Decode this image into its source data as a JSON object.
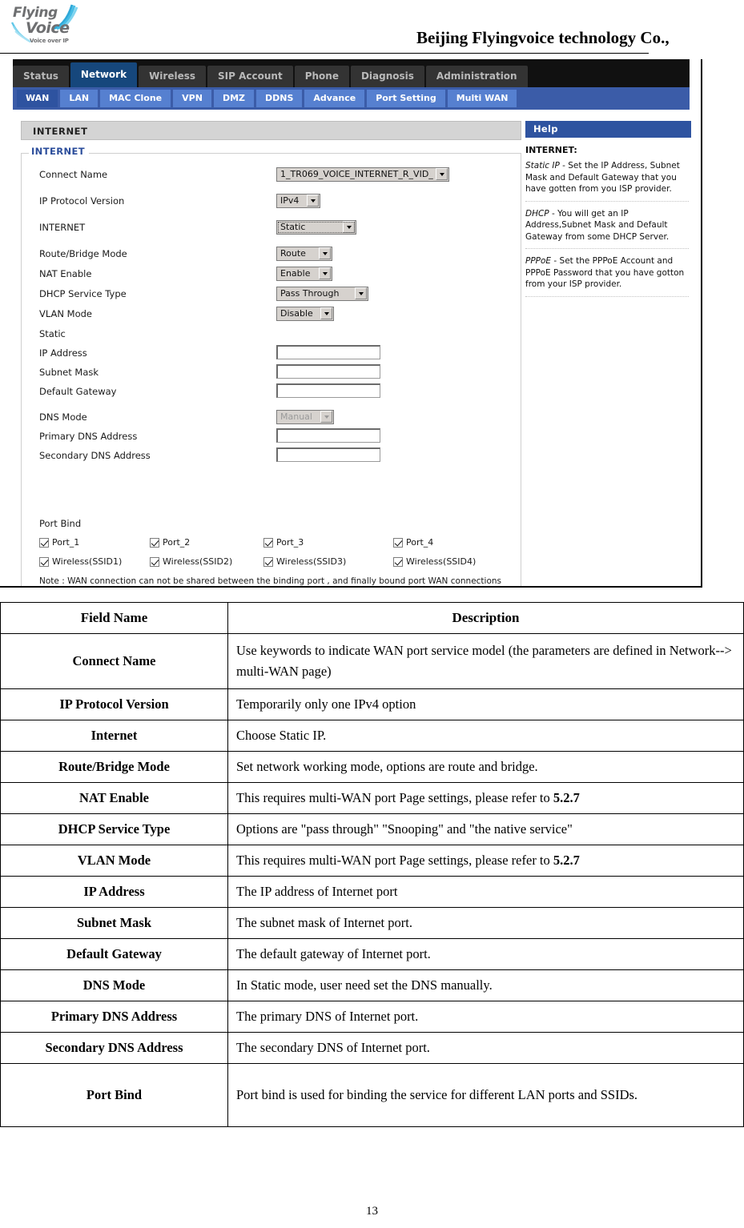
{
  "header": {
    "company": "Beijing Flyingvoice technology Co.,",
    "logo": {
      "word1": "Flying",
      "word2": "Voice",
      "tagline": "Voice over IP"
    }
  },
  "router": {
    "top_nav": [
      {
        "label": "Status",
        "active": false
      },
      {
        "label": "Network",
        "active": true
      },
      {
        "label": "Wireless",
        "active": false
      },
      {
        "label": "SIP Account",
        "active": false
      },
      {
        "label": "Phone",
        "active": false
      },
      {
        "label": "Diagnosis",
        "active": false
      },
      {
        "label": "Administration",
        "active": false
      }
    ],
    "sub_nav": [
      {
        "label": "WAN",
        "active": true
      },
      {
        "label": "LAN",
        "active": false
      },
      {
        "label": "MAC Clone",
        "active": false
      },
      {
        "label": "VPN",
        "active": false
      },
      {
        "label": "DMZ",
        "active": false
      },
      {
        "label": "DDNS",
        "active": false
      },
      {
        "label": "Advance",
        "active": false
      },
      {
        "label": "Port Setting",
        "active": false
      },
      {
        "label": "Multi WAN",
        "active": false
      }
    ],
    "section_title": "INTERNET",
    "fieldset_legend": "INTERNET",
    "form": {
      "connect_name": {
        "label": "Connect Name",
        "value": "1_TR069_VOICE_INTERNET_R_VID_"
      },
      "ip_protocol_version": {
        "label": "IP Protocol Version",
        "value": "IPv4"
      },
      "internet": {
        "label": "INTERNET",
        "value": "Static"
      },
      "route_bridge_mode": {
        "label": "Route/Bridge Mode",
        "value": "Route"
      },
      "nat_enable": {
        "label": "NAT Enable",
        "value": "Enable"
      },
      "dhcp_service_type": {
        "label": "DHCP Service Type",
        "value": "Pass Through"
      },
      "vlan_mode": {
        "label": "VLAN Mode",
        "value": "Disable"
      },
      "static_label": "Static",
      "ip_address": {
        "label": "IP Address",
        "value": ""
      },
      "subnet_mask": {
        "label": "Subnet Mask",
        "value": ""
      },
      "default_gateway": {
        "label": "Default Gateway",
        "value": ""
      },
      "dns_mode": {
        "label": "DNS Mode",
        "value": "Manual"
      },
      "primary_dns": {
        "label": "Primary DNS Address",
        "value": ""
      },
      "secondary_dns": {
        "label": "Secondary DNS Address",
        "value": ""
      }
    },
    "port_bind": {
      "label": "Port Bind",
      "ports": [
        "Port_1",
        "Port_2",
        "Port_3",
        "Port_4"
      ],
      "wireless": [
        "Wireless(SSID1)",
        "Wireless(SSID2)",
        "Wireless(SSID3)",
        "Wireless(SSID4)"
      ],
      "note": "Note : WAN connection can not be shared between the binding port , and finally bound port WAN connections bind operation will wash away before the other WAN connection to the port binding operation !"
    },
    "help": {
      "title": "Help",
      "heading": "INTERNET:",
      "blocks": [
        {
          "term": "Static IP",
          "text": " - Set the IP Address, Subnet Mask and Default Gateway that you have gotten from you ISP provider."
        },
        {
          "term": "DHCP",
          "text": " - You will get an IP Address,Subnet Mask and Default Gateway from some DHCP Server."
        },
        {
          "term": "PPPoE",
          "text": " - Set the PPPoE Account and PPPoE Password that you have gotton from your ISP provider."
        }
      ]
    }
  },
  "table": {
    "headers": [
      "Field Name",
      "Description"
    ],
    "rows": [
      {
        "field": "Connect    Name",
        "desc": "Use keywords to indicate WAN port service model (the parameters are defined in Network--> multi-WAN page)",
        "two_line": true
      },
      {
        "field": "IP Protocol Version",
        "desc": "Temporarily only one IPv4 option",
        "two_line": false
      },
      {
        "field": "Internet",
        "desc": "Choose Static IP.",
        "two_line": false
      },
      {
        "field": "Route/Bridge Mode",
        "desc": "Set network working mode, options are route and bridge.",
        "two_line": false
      },
      {
        "field": "NAT Enable",
        "desc": "This requires multi-WAN port Page settings, please refer to ",
        "ref": "5.2.7",
        "two_line": false
      },
      {
        "field": "DHCP Service Type",
        "desc": "Options are \"pass through\" \"Snooping\" and \"the native service\"",
        "two_line": false
      },
      {
        "field": "VLAN Mode",
        "desc": "This requires multi-WAN port Page settings, please refer to ",
        "ref": "5.2.7",
        "two_line": false
      },
      {
        "field": "IP Address",
        "desc": "The IP address of Internet port",
        "two_line": false
      },
      {
        "field": "Subnet Mask",
        "desc": "The subnet mask of Internet port.",
        "two_line": false
      },
      {
        "field": "Default Gateway",
        "desc": "The default gateway of Internet port.",
        "two_line": false
      },
      {
        "field": "DNS Mode",
        "desc": "In Static mode, user need set the DNS manually.",
        "two_line": false
      },
      {
        "field": "Primary DNS Address",
        "desc": "The primary DNS of Internet port.",
        "two_line": false
      },
      {
        "field": "Secondary DNS Address",
        "desc": "The secondary DNS of Internet port.",
        "two_line": false
      },
      {
        "field": "Port Bind",
        "desc": "Port bind is used for binding the service for different LAN ports and SSIDs.",
        "two_line": true
      }
    ]
  },
  "page_number": "13"
}
